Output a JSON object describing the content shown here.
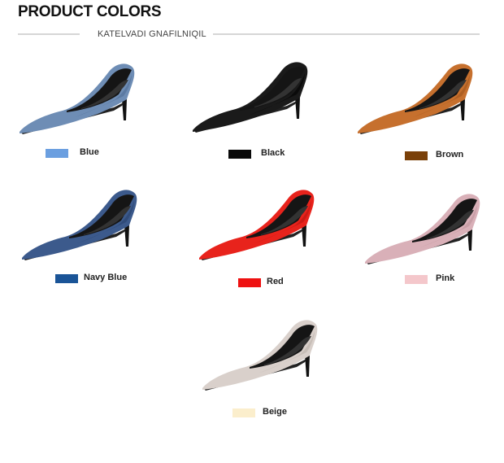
{
  "header": {
    "title": "PRODUCT COLORS",
    "subtitle": "KATELVADI GNAFILNIQIL"
  },
  "colors": [
    {
      "label": "Blue",
      "swatch": "#6b9fe0",
      "shoe": "#6e8db5",
      "shoe_dark": "#4f6c92"
    },
    {
      "label": "Black",
      "swatch": "#0a0a0a",
      "shoe": "#1a1a1a",
      "shoe_dark": "#000000"
    },
    {
      "label": "Brown",
      "swatch": "#7a4009",
      "shoe": "#c6702e",
      "shoe_dark": "#9a521c"
    },
    {
      "label": "Navy Blue",
      "swatch": "#1a5497",
      "shoe": "#3c5a8c",
      "shoe_dark": "#263f6a"
    },
    {
      "label": "Red",
      "swatch": "#ee1111",
      "shoe": "#e8231c",
      "shoe_dark": "#b21410"
    },
    {
      "label": "Pink",
      "swatch": "#f4c7cb",
      "shoe": "#d9b0b8",
      "shoe_dark": "#b98f98"
    },
    {
      "label": "Beige",
      "swatch": "#fbeecc",
      "shoe": "#d9d0cb",
      "shoe_dark": "#b8aea8"
    }
  ]
}
